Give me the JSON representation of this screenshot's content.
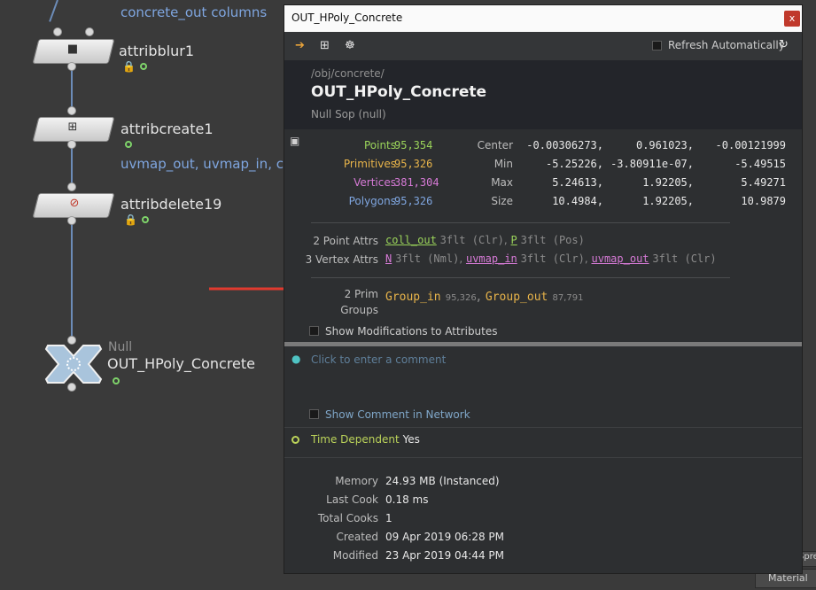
{
  "network": {
    "notes": {
      "top": "concrete_out columns",
      "mid": "uvmap_out, uvmap_in, co"
    },
    "nodes": [
      {
        "name": "attribblur1"
      },
      {
        "name": "attribcreate1"
      },
      {
        "name": "attribdelete19"
      },
      {
        "type": "Null",
        "name": "OUT_HPoly_Concrete"
      }
    ],
    "right_edge_labels": [
      "Spre",
      "Material St"
    ]
  },
  "panel": {
    "title": "OUT_HPoly_Concrete",
    "close_label": "x",
    "toolbar": {
      "refresh_label": "Refresh Automatically"
    },
    "header": {
      "path": "/obj/concrete/",
      "node_name": "OUT_HPoly_Concrete",
      "node_type": "Null Sop (null)"
    },
    "counts": [
      {
        "label": "Points",
        "value": "95,354",
        "color": "#9bd45a"
      },
      {
        "label": "Primitives",
        "value": "95,326",
        "color": "#e8b44a"
      },
      {
        "label": "Vertices",
        "value": "381,304",
        "color": "#d67ad6"
      },
      {
        "label": "Polygons",
        "value": "95,326",
        "color": "#7fa6e0"
      }
    ],
    "bounds": [
      {
        "label": "Center",
        "v": [
          "-0.00306273,",
          "0.961023,",
          "-0.00121999"
        ]
      },
      {
        "label": "Min",
        "v": [
          "-5.25226,",
          "-3.80911e-07,",
          "-5.49515"
        ]
      },
      {
        "label": "Max",
        "v": [
          "5.24613,",
          "1.92205,",
          "5.49271"
        ]
      },
      {
        "label": "Size",
        "v": [
          "10.4984,",
          "1.92205,",
          "10.9879"
        ]
      }
    ],
    "point_attrs": {
      "label": "2 Point Attrs",
      "items": [
        {
          "name": "coll_out",
          "desc": "3flt (Clr)"
        },
        {
          "name": "P",
          "desc": "3flt (Pos)"
        }
      ]
    },
    "vertex_attrs": {
      "label": "3 Vertex Attrs",
      "items": [
        {
          "name": "N",
          "desc": "3flt (Nml)"
        },
        {
          "name": "uvmap_in",
          "desc": "3flt (Clr)"
        },
        {
          "name": "uvmap_out",
          "desc": "3flt (Clr)"
        }
      ]
    },
    "prim_groups": {
      "label_line1": "2 Prim",
      "label_line2": "Groups",
      "items": [
        {
          "name": "Group_in",
          "count": "95,326"
        },
        {
          "name": "Group_out",
          "count": "87,791"
        }
      ]
    },
    "show_mods_label": "Show Modifications to Attributes",
    "comment_placeholder": "Click to enter a comment",
    "show_comment_label": "Show Comment in Network",
    "time_dependent": {
      "label": "Time Dependent",
      "value": "Yes"
    },
    "stats": [
      {
        "label": "Memory",
        "value": "24.93 MB (Instanced)"
      },
      {
        "label": "Last Cook",
        "value": "0.18 ms"
      },
      {
        "label": "Total Cooks",
        "value": "1"
      },
      {
        "label": "Created",
        "value": "09 Apr 2019 06:28 PM"
      },
      {
        "label": "Modified",
        "value": "23 Apr 2019 04:44 PM"
      }
    ]
  },
  "colors": {
    "points": "#9bd45a",
    "primitives": "#e8b44a",
    "vertices": "#d67ad6",
    "polygons": "#7fa6e0",
    "accent": "#4fc3c3"
  }
}
